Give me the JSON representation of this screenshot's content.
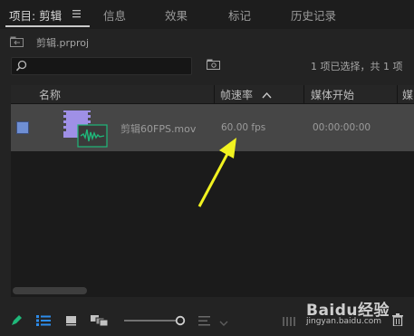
{
  "tabs": [
    {
      "label": "项目: 剪辑"
    },
    {
      "label": "信息"
    },
    {
      "label": "效果"
    },
    {
      "label": "标记"
    },
    {
      "label": "历史记录"
    }
  ],
  "project": {
    "file_name": "剪辑.prproj"
  },
  "search": {
    "placeholder": ""
  },
  "selection_status": "1 项已选择，共 1 项",
  "columns": {
    "name": "名称",
    "frame_rate": "帧速率",
    "media_start": "媒体开始",
    "media_cut": "媒"
  },
  "items": [
    {
      "name": "剪辑60FPS.mov",
      "frame_rate": "60.00 fps",
      "media_start": "00:00:00:00",
      "label_color": "#6f8fd4"
    }
  ],
  "watermark": {
    "text": "Baidu经验",
    "subtext": "jingyan.baidu.com"
  },
  "colors": {
    "accent": "#2d8ceb",
    "annotation_arrow": "#f1f220",
    "audio_icon": "#1fb87a",
    "video_icon": "#9f90e6"
  }
}
